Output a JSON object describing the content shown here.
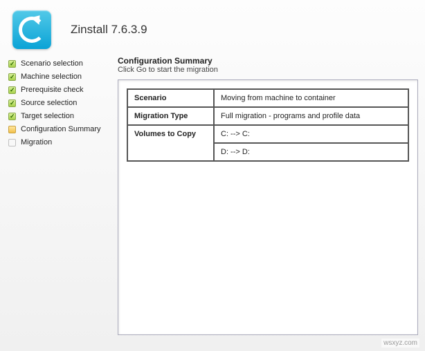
{
  "header": {
    "title": "Zinstall 7.6.3.9"
  },
  "sidebar": {
    "items": [
      {
        "label": "Scenario selection",
        "state": "done"
      },
      {
        "label": "Machine selection",
        "state": "done"
      },
      {
        "label": "Prerequisite check",
        "state": "done"
      },
      {
        "label": "Source selection",
        "state": "done"
      },
      {
        "label": "Target selection",
        "state": "done"
      },
      {
        "label": "Configuration Summary",
        "state": "active"
      },
      {
        "label": "Migration",
        "state": "pending"
      }
    ]
  },
  "content": {
    "title": "Configuration Summary",
    "subtitle": "Click Go to start the migration",
    "rows": {
      "scenario_label": "Scenario",
      "scenario_value": "Moving from machine to container",
      "migration_type_label": "Migration Type",
      "migration_type_value": "Full migration - programs and profile data",
      "volumes_label": "Volumes to Copy",
      "volumes_v1": "C: --> C:",
      "volumes_v2": "D: --> D:"
    }
  },
  "watermark": "wsxyz.com"
}
